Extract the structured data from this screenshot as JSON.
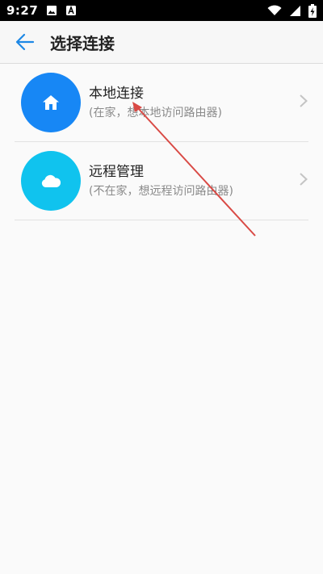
{
  "status_bar": {
    "time": "9:27",
    "icons": [
      "image-icon",
      "a-notification-icon",
      "wifi-icon",
      "signal-icon",
      "battery-charging-icon"
    ]
  },
  "app_bar": {
    "back_icon": "arrow-left-icon",
    "title": "选择连接",
    "accent": "#1e88e5"
  },
  "options": [
    {
      "title": "本地连接",
      "subtitle": "(在家，想本地访问路由器)",
      "icon": "home-icon",
      "color": "#1787f5"
    },
    {
      "title": "远程管理",
      "subtitle": "(不在家，想远程访问路由器)",
      "icon": "cloud-icon",
      "color": "#10c3ee"
    }
  ],
  "annotation": {
    "type": "red-arrow",
    "color": "#d94a45"
  }
}
